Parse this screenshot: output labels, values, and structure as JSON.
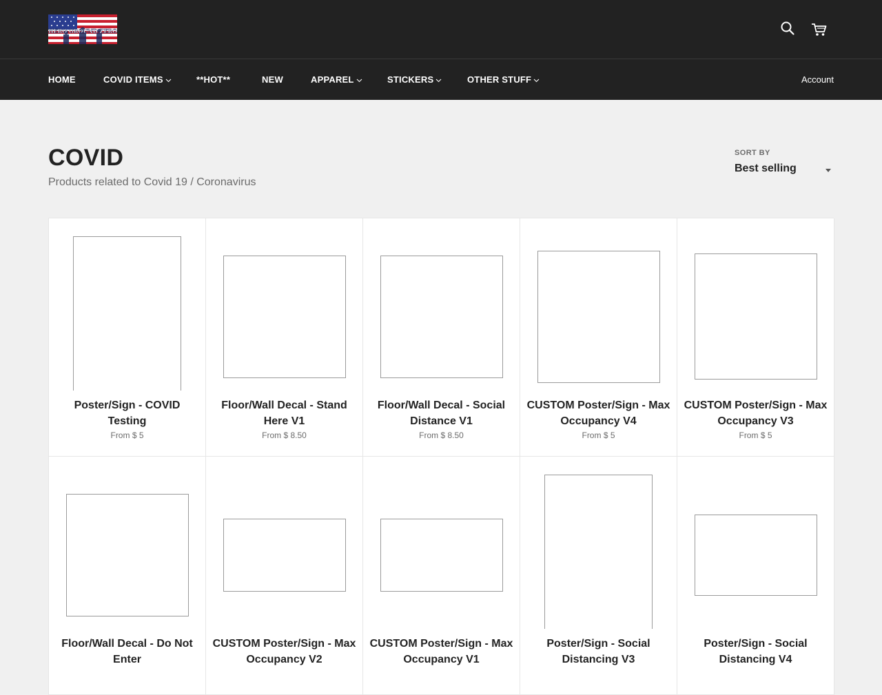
{
  "header": {
    "logo_text": "HERO GROUND ZERO",
    "search_icon": "search-icon",
    "cart_icon": "cart-icon"
  },
  "nav": {
    "items": [
      {
        "label": "HOME",
        "has_dropdown": false
      },
      {
        "label": "COVID ITEMS",
        "has_dropdown": true
      },
      {
        "label": "**HOT**",
        "has_dropdown": false
      },
      {
        "label": "NEW",
        "has_dropdown": false
      },
      {
        "label": "APPAREL",
        "has_dropdown": true
      },
      {
        "label": "STICKERS",
        "has_dropdown": true
      },
      {
        "label": "OTHER STUFF",
        "has_dropdown": true
      }
    ],
    "account": "Account"
  },
  "collection": {
    "title": "COVID",
    "description": "Products related to Covid 19 / Coronavirus"
  },
  "sort": {
    "label": "SORT BY",
    "selected": "Best selling"
  },
  "products": [
    {
      "title": "Poster/Sign - COVID Testing",
      "price": "From $ 5"
    },
    {
      "title": "Floor/Wall Decal - Stand Here V1",
      "price": "From $ 8.50"
    },
    {
      "title": "Floor/Wall Decal - Social Distance V1",
      "price": "From $ 8.50"
    },
    {
      "title": "CUSTOM Poster/Sign - Max Occupancy V4",
      "price": "From $ 5"
    },
    {
      "title": "CUSTOM Poster/Sign - Max Occupancy V3",
      "price": "From $ 5"
    },
    {
      "title": "Floor/Wall Decal - Do Not Enter",
      "price": ""
    },
    {
      "title": "CUSTOM Poster/Sign - Max Occupancy V2",
      "price": ""
    },
    {
      "title": "CUSTOM Poster/Sign - Max Occupancy V1",
      "price": ""
    },
    {
      "title": "Poster/Sign - Social Distancing V3",
      "price": ""
    },
    {
      "title": "Poster/Sign - Social Distancing V4",
      "price": ""
    }
  ],
  "colors": {
    "header_bg": "#222222",
    "page_bg": "#f0f0f0",
    "card_bg": "#ffffff",
    "muted_text": "#6b6b6b"
  }
}
